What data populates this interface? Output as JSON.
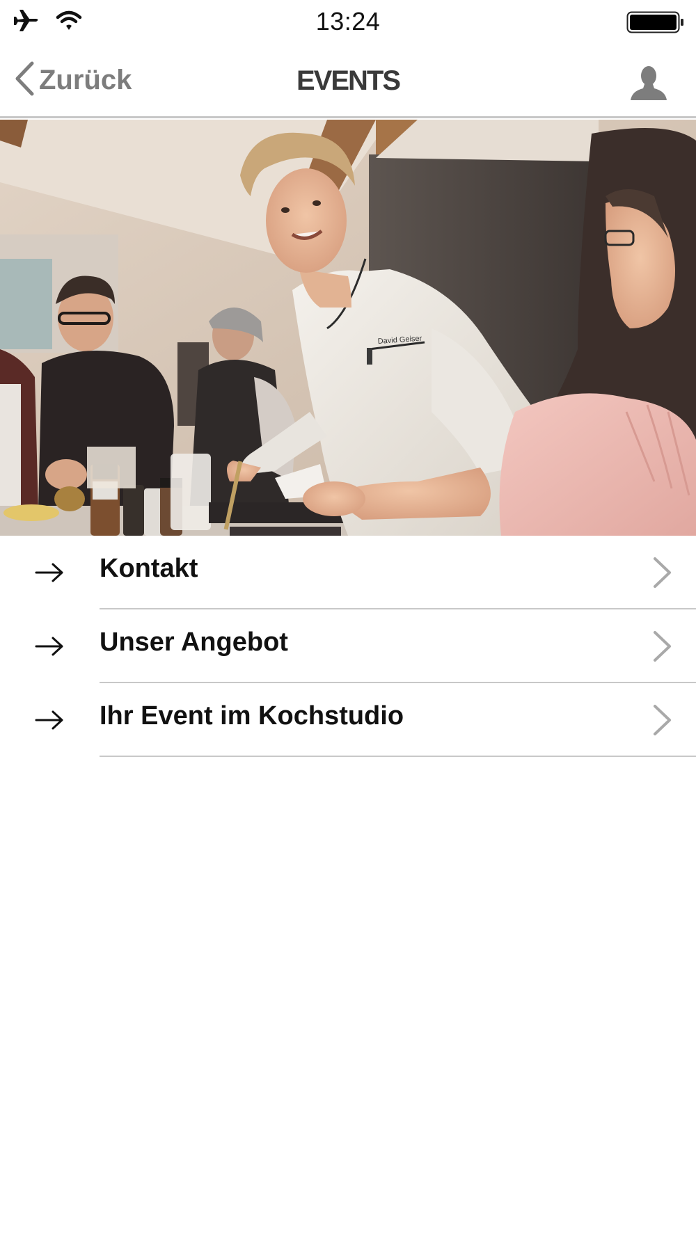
{
  "status_bar": {
    "time": "13:24",
    "icons": [
      "airplane-icon",
      "wifi-icon",
      "battery-icon"
    ]
  },
  "nav": {
    "back_label": "Zurück",
    "title": "EVENTS",
    "profile_icon": "user-icon"
  },
  "hero": {
    "description_icon": "photo",
    "name_tag": "David Geiser"
  },
  "menu": {
    "items": [
      {
        "label": "Kontakt",
        "icon": "arrow-right-icon"
      },
      {
        "label": "Unser Angebot",
        "icon": "arrow-right-icon"
      },
      {
        "label": "Ihr Event im Kochstudio",
        "icon": "arrow-right-icon"
      }
    ]
  },
  "colors": {
    "nav_text": "#7d7d7d",
    "title_text": "#3a3a3a",
    "divider": "#c8c8c8",
    "chevron": "#a9a9a9"
  }
}
